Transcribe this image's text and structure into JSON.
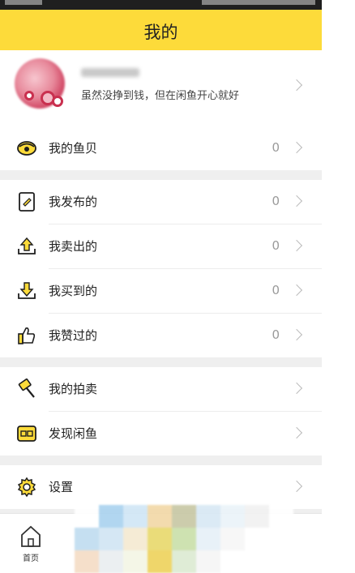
{
  "header": {
    "title": "我的"
  },
  "profile": {
    "username": "luoyao???",
    "signature": "虽然没挣到钱，但在闲鱼开心就好"
  },
  "groups": [
    {
      "items": [
        {
          "label": "我的鱼贝",
          "count": "0",
          "icon": "shell-icon"
        }
      ]
    },
    {
      "items": [
        {
          "label": "我发布的",
          "count": "0",
          "icon": "publish-icon"
        },
        {
          "label": "我卖出的",
          "count": "0",
          "icon": "sold-icon"
        },
        {
          "label": "我买到的",
          "count": "0",
          "icon": "bought-icon"
        },
        {
          "label": "我赞过的",
          "count": "0",
          "icon": "thumbs-up-icon"
        }
      ]
    },
    {
      "items": [
        {
          "label": "我的拍卖",
          "icon": "auction-hammer-icon"
        },
        {
          "label": "发现闲鱼",
          "icon": "fish-box-icon"
        }
      ]
    },
    {
      "items": [
        {
          "label": "设置",
          "icon": "gear-icon"
        }
      ]
    }
  ],
  "tabbar": {
    "home_label": "首页"
  },
  "colors": {
    "accent": "#fddb3a",
    "icon": "#1e1e1e",
    "icon_fill": "#fddb3a",
    "background": "#efefef"
  }
}
